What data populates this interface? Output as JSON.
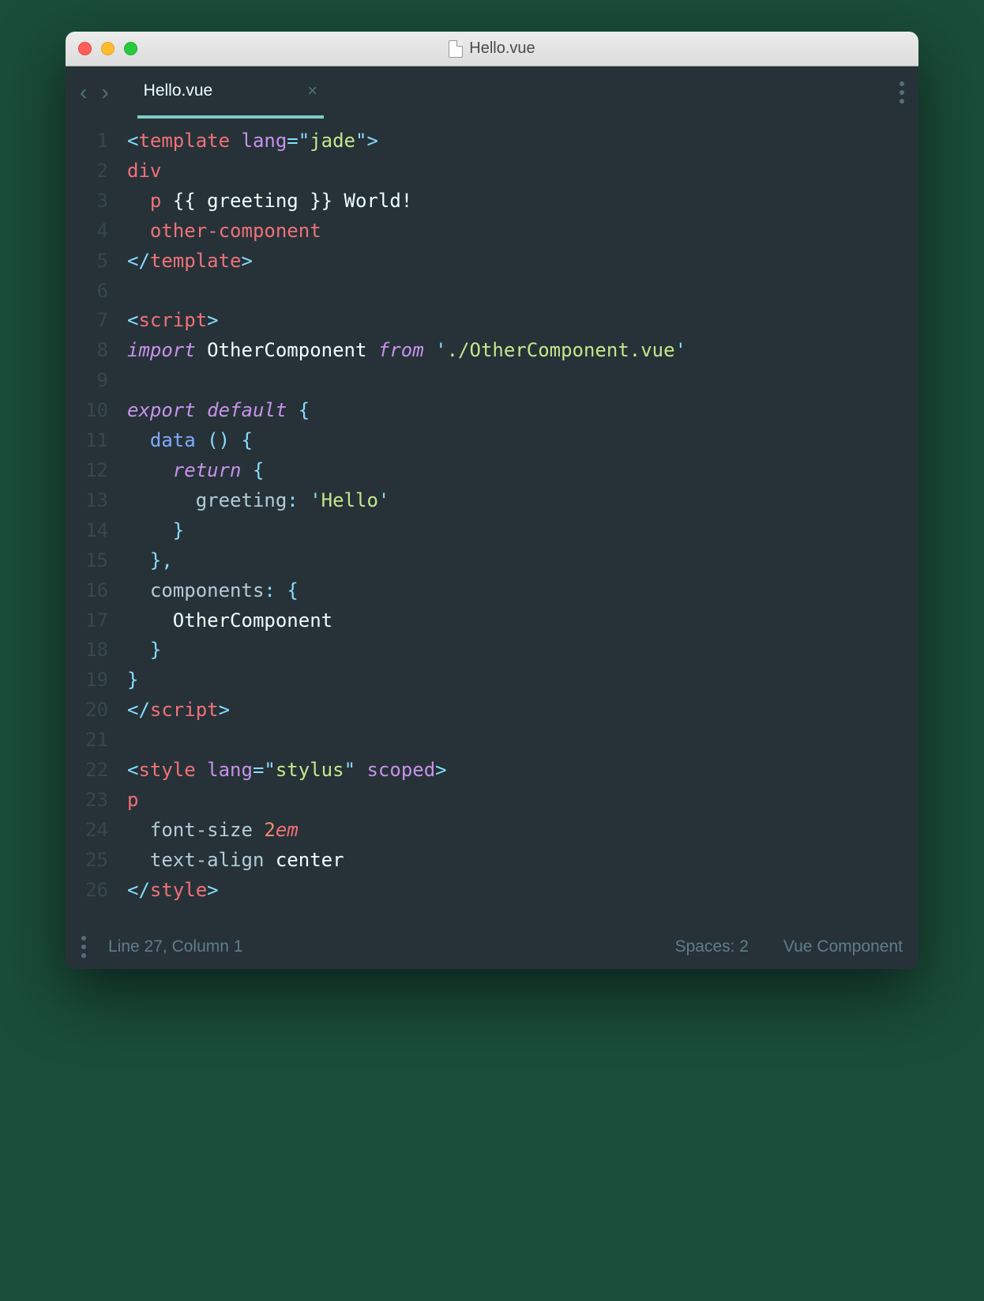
{
  "window": {
    "title": "Hello.vue"
  },
  "tab": {
    "name": "Hello.vue"
  },
  "status": {
    "position": "Line 27, Column 1",
    "spaces": "Spaces: 2",
    "syntax": "Vue Component"
  },
  "code": {
    "lines": [
      [
        [
          "p",
          "<"
        ],
        [
          "tg",
          "template"
        ],
        [
          "id",
          " "
        ],
        [
          "at",
          "lang"
        ],
        [
          "p",
          "="
        ],
        [
          "p",
          "\""
        ],
        [
          "st",
          "jade"
        ],
        [
          "p",
          "\""
        ],
        [
          "p",
          ">"
        ]
      ],
      [
        [
          "tg",
          "div"
        ]
      ],
      [
        [
          "id",
          "  "
        ],
        [
          "tg",
          "p"
        ],
        [
          "id",
          " {{ greeting }} World!"
        ]
      ],
      [
        [
          "id",
          "  "
        ],
        [
          "tg",
          "other-component"
        ]
      ],
      [
        [
          "p",
          "</"
        ],
        [
          "tg",
          "template"
        ],
        [
          "p",
          ">"
        ]
      ],
      [],
      [
        [
          "p",
          "<"
        ],
        [
          "tg",
          "script"
        ],
        [
          "p",
          ">"
        ]
      ],
      [
        [
          "kw",
          "import"
        ],
        [
          "id",
          " OtherComponent "
        ],
        [
          "kw",
          "from"
        ],
        [
          "id",
          " "
        ],
        [
          "p",
          "'"
        ],
        [
          "st",
          "./OtherComponent.vue"
        ],
        [
          "p",
          "'"
        ]
      ],
      [],
      [
        [
          "kw",
          "export"
        ],
        [
          "id",
          " "
        ],
        [
          "kw",
          "default"
        ],
        [
          "id",
          " "
        ],
        [
          "p",
          "{"
        ]
      ],
      [
        [
          "id",
          "  "
        ],
        [
          "fn",
          "data"
        ],
        [
          "id",
          " "
        ],
        [
          "p",
          "()"
        ],
        [
          "id",
          " "
        ],
        [
          "p",
          "{"
        ]
      ],
      [
        [
          "id",
          "    "
        ],
        [
          "kw",
          "return"
        ],
        [
          "id",
          " "
        ],
        [
          "p",
          "{"
        ]
      ],
      [
        [
          "id",
          "      "
        ],
        [
          "co",
          "greeting"
        ],
        [
          "op",
          ":"
        ],
        [
          "id",
          " "
        ],
        [
          "p",
          "'"
        ],
        [
          "st",
          "Hello"
        ],
        [
          "p",
          "'"
        ]
      ],
      [
        [
          "id",
          "    "
        ],
        [
          "p",
          "}"
        ]
      ],
      [
        [
          "id",
          "  "
        ],
        [
          "p",
          "},"
        ]
      ],
      [
        [
          "id",
          "  "
        ],
        [
          "co",
          "components"
        ],
        [
          "op",
          ":"
        ],
        [
          "id",
          " "
        ],
        [
          "p",
          "{"
        ]
      ],
      [
        [
          "id",
          "    "
        ],
        [
          "id",
          "OtherComponent"
        ]
      ],
      [
        [
          "id",
          "  "
        ],
        [
          "p",
          "}"
        ]
      ],
      [
        [
          "p",
          "}"
        ]
      ],
      [
        [
          "p",
          "</"
        ],
        [
          "tg",
          "script"
        ],
        [
          "p",
          ">"
        ]
      ],
      [],
      [
        [
          "p",
          "<"
        ],
        [
          "tg",
          "style"
        ],
        [
          "id",
          " "
        ],
        [
          "at",
          "lang"
        ],
        [
          "p",
          "="
        ],
        [
          "p",
          "\""
        ],
        [
          "st",
          "stylus"
        ],
        [
          "p",
          "\""
        ],
        [
          "id",
          " "
        ],
        [
          "at",
          "scoped"
        ],
        [
          "p",
          ">"
        ]
      ],
      [
        [
          "tg",
          "p"
        ]
      ],
      [
        [
          "id",
          "  "
        ],
        [
          "co",
          "font-size"
        ],
        [
          "id",
          " "
        ],
        [
          "nm",
          "2"
        ],
        [
          "un",
          "em"
        ]
      ],
      [
        [
          "id",
          "  "
        ],
        [
          "co",
          "text-align"
        ],
        [
          "id",
          " "
        ],
        [
          "id",
          "center"
        ]
      ],
      [
        [
          "p",
          "</"
        ],
        [
          "tg",
          "style"
        ],
        [
          "p",
          ">"
        ]
      ]
    ]
  }
}
